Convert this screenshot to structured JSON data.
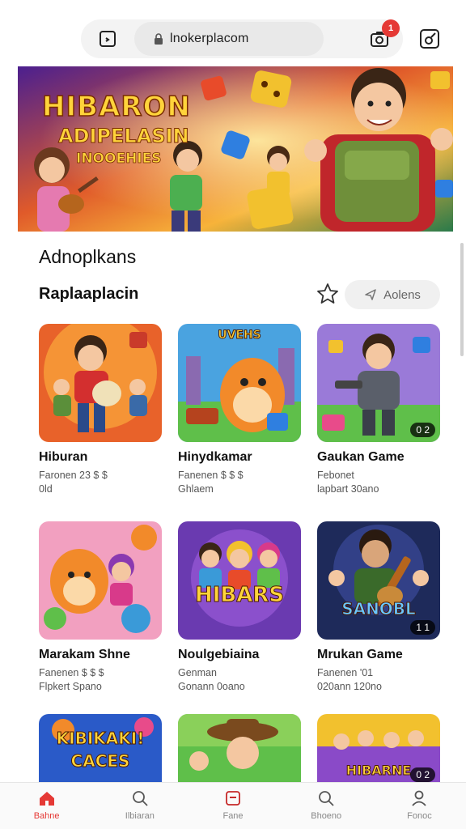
{
  "browser": {
    "url": "lnokerplacom",
    "notification_count": "1"
  },
  "hero": {
    "title": "HIBARON",
    "subtitle_1": "ADIPELASIN",
    "subtitle_2": "INOOEHIES"
  },
  "section_title": "Adnoplkans",
  "subsection": {
    "title": "Raplaaplacin",
    "reviews_label": "Aolens"
  },
  "cards": [
    {
      "title": "Hiburan",
      "meta1": "Faronen 23 $ $",
      "meta2": "0ld",
      "badge": "",
      "thumb_text": "",
      "icon": "kid-with-pet-art"
    },
    {
      "title": "Hinydkamar",
      "meta1": "Fanenen $ $ $",
      "meta2": "Ghlaem",
      "badge": "",
      "thumb_text": "UVEHS",
      "icon": "orange-creature-art"
    },
    {
      "title": "Gaukan Game",
      "meta1": "Febonet",
      "meta2": "lapbart 30ano",
      "badge": "0 2",
      "thumb_text": "",
      "icon": "robot-soldier-art"
    },
    {
      "title": "Marakam Shne",
      "meta1": "Fanenen $ $ $",
      "meta2": "Flpkert Spano",
      "badge": "",
      "thumb_text": "",
      "icon": "fox-candy-art"
    },
    {
      "title": "Noulgebiaina",
      "meta1": "Genman",
      "meta2": "Gonann 0oano",
      "badge": "",
      "thumb_text": "HIBARS",
      "icon": "group-heroes-art"
    },
    {
      "title": "Mrukan Game",
      "meta1": "Fanenen '01",
      "meta2": "020ann 120no",
      "badge": "1 1",
      "thumb_text": "SANOBL",
      "icon": "guitarist-art"
    },
    {
      "title": "",
      "meta1": "",
      "meta2": "",
      "badge": "",
      "thumb_text": "KIBIKAKI! CACES",
      "icon": "cacti-art"
    },
    {
      "title": "",
      "meta1": "",
      "meta2": "",
      "badge": "",
      "thumb_text": "",
      "icon": "cowboy-art"
    },
    {
      "title": "",
      "meta1": "",
      "meta2": "",
      "badge": "0 2",
      "thumb_text": "HIBARNE",
      "icon": "party-art"
    }
  ],
  "nav": [
    {
      "label": "Bahne",
      "icon": "home-icon",
      "active": true
    },
    {
      "label": "Ilbiaran",
      "icon": "search-icon",
      "active": false
    },
    {
      "label": "Fane",
      "icon": "square-icon",
      "active": false
    },
    {
      "label": "Bhoeno",
      "icon": "search-icon",
      "active": false
    },
    {
      "label": "Fonoc",
      "icon": "user-icon",
      "active": false
    }
  ],
  "colors": {
    "accent": "#e53935",
    "hero_title": "#ffd43b"
  }
}
